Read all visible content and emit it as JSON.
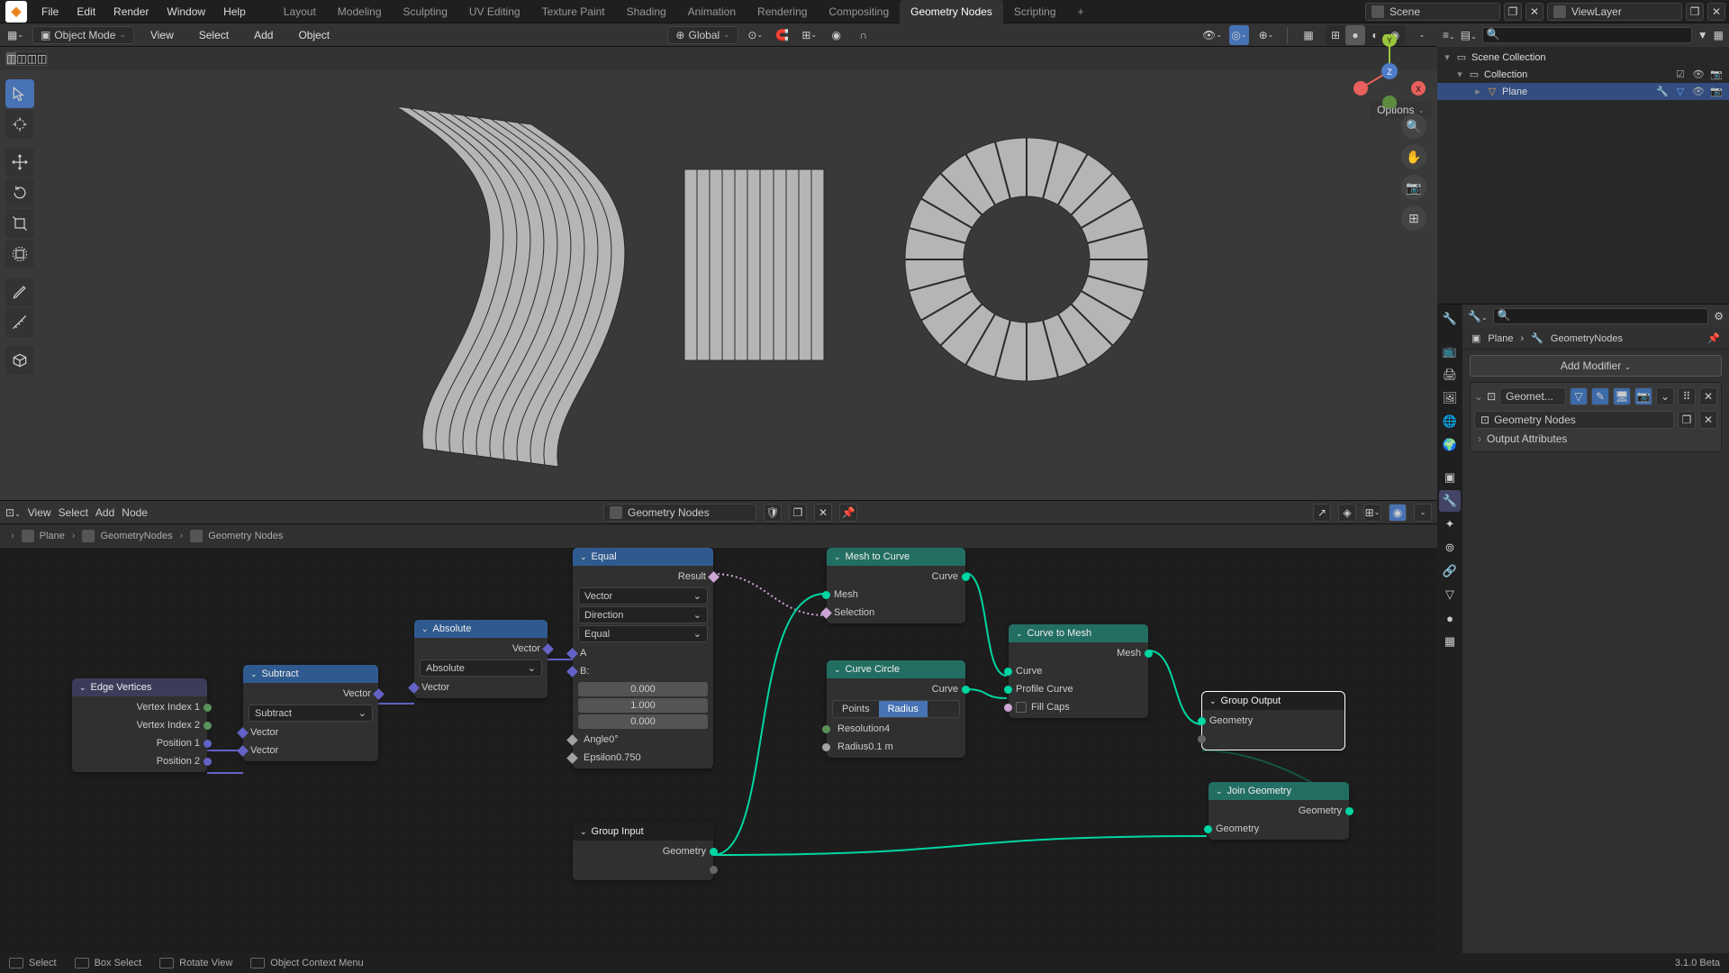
{
  "topbar": {
    "menus": [
      "File",
      "Edit",
      "Render",
      "Window",
      "Help"
    ],
    "workspaces": [
      "Layout",
      "Modeling",
      "Sculpting",
      "UV Editing",
      "Texture Paint",
      "Shading",
      "Animation",
      "Rendering",
      "Compositing",
      "Geometry Nodes",
      "Scripting"
    ],
    "active_workspace": 9,
    "scene": "Scene",
    "viewlayer": "ViewLayer"
  },
  "viewport": {
    "mode": "Object Mode",
    "menus": [
      "View",
      "Select",
      "Add",
      "Object"
    ],
    "orientation": "Global",
    "options_label": "Options",
    "gizmo": {
      "x": "X",
      "y": "Y",
      "z": "Z"
    }
  },
  "outliner": {
    "root": "Scene Collection",
    "collection": "Collection",
    "object": "Plane"
  },
  "properties": {
    "breadcrumb_obj": "Plane",
    "breadcrumb_mod": "GeometryNodes",
    "add_modifier": "Add Modifier",
    "modifier_name": "Geomet...",
    "nodegroup": "Geometry Nodes",
    "output_attributes": "Output Attributes"
  },
  "node_editor": {
    "menus": [
      "View",
      "Select",
      "Add",
      "Node"
    ],
    "nodegroup_name": "Geometry Nodes",
    "breadcrumb": [
      "Plane",
      "GeometryNodes",
      "Geometry Nodes"
    ],
    "nodes": {
      "edge_vertices": {
        "title": "Edge Vertices",
        "outputs": [
          "Vertex Index 1",
          "Vertex Index 2",
          "Position 1",
          "Position 2"
        ]
      },
      "subtract": {
        "title": "Subtract",
        "out": "Vector",
        "op": "Subtract",
        "in1": "Vector",
        "in2": "Vector"
      },
      "absolute": {
        "title": "Absolute",
        "out": "Vector",
        "op": "Absolute",
        "in": "Vector"
      },
      "equal": {
        "title": "Equal",
        "out": "Result",
        "type": "Vector",
        "mode": "Direction",
        "op": "Equal",
        "a": "A",
        "b": "B:",
        "bx": "0.000",
        "by": "1.000",
        "bz": "0.000",
        "angle_label": "Angle",
        "angle_val": "0°",
        "eps_label": "Epsilon",
        "eps_val": "0.750"
      },
      "mesh_to_curve": {
        "title": "Mesh to Curve",
        "out": "Curve",
        "in_mesh": "Mesh",
        "in_sel": "Selection"
      },
      "curve_circle": {
        "title": "Curve Circle",
        "out": "Curve",
        "mode_points": "Points",
        "mode_radius": "Radius",
        "res_label": "Resolution",
        "res_val": "4",
        "rad_label": "Radius",
        "rad_val": "0.1 m"
      },
      "curve_to_mesh": {
        "title": "Curve to Mesh",
        "out": "Mesh",
        "in_curve": "Curve",
        "in_profile": "Profile Curve",
        "fill": "Fill Caps"
      },
      "group_input": {
        "title": "Group Input",
        "out": "Geometry"
      },
      "group_output": {
        "title": "Group Output",
        "in": "Geometry"
      },
      "join_geometry": {
        "title": "Join Geometry",
        "out": "Geometry",
        "in": "Geometry"
      }
    }
  },
  "statusbar": {
    "select": "Select",
    "box": "Box Select",
    "rotate": "Rotate View",
    "ctx": "Object Context Menu",
    "version": "3.1.0 Beta"
  }
}
